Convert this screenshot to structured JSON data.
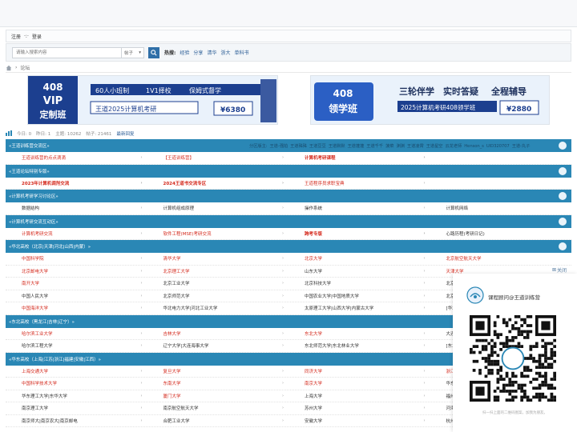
{
  "topbar": {
    "faint_text": ""
  },
  "userbar": {
    "register": "注册",
    "sep": "·:·",
    "login": "登录"
  },
  "search": {
    "placeholder": "请输入搜索内容",
    "type_value": "帖子",
    "hot_label": "热搜:",
    "hot_items": [
      "经验",
      "分享",
      "清华",
      "浙大",
      "单科书"
    ]
  },
  "breadcrumb": {
    "current": "论坛"
  },
  "banners": {
    "left": {
      "badge": "408",
      "vip": "VIP",
      "sub": "定制班",
      "tags": [
        "60人小班制",
        "1V1择校",
        "保姆式督学"
      ],
      "course": "王道2025计算机考研",
      "price": "¥6380"
    },
    "right": {
      "badge": "408",
      "sub": "领学班",
      "tags": [
        "三轮伴学",
        "实时答疑",
        "全程辅导"
      ],
      "course": "2025计算机考研408领学班",
      "price": "¥2880"
    }
  },
  "stats": {
    "today": "今日: 0",
    "yesterday": "昨日: 1",
    "topics": "主题: 10262",
    "posts": "帖子: 21461",
    "newest": "最新回复"
  },
  "sections": [
    {
      "title": "«王道训练营交流区»",
      "moderators_label": "分区版主:",
      "moderators": [
        "王道-强拍",
        "王道殊殊",
        "王道豆豆",
        "王道默默",
        "王道蓬蓬",
        "王道千千",
        "菠菜",
        "渊渊",
        "王道凌霄",
        "王道星空",
        "云龙老师",
        "Henson_s",
        "UID320707",
        "王道-丸子"
      ],
      "rows": [
        [
          {
            "t": "王道训练营的点点滴滴",
            "c": "red"
          },
          {
            "t": "【王道训练营】",
            "c": "red"
          },
          {
            "t": "计算机考研课程",
            "c": "red",
            "b": true
          },
          {
            "t": ""
          }
        ]
      ]
    },
    {
      "title": "«王道论坛特别专版»",
      "rows": [
        [
          {
            "t": "2023年计算机调剂交流",
            "c": "red",
            "b": true
          },
          {
            "t": "2024王道书交流专区",
            "c": "red",
            "b": true
          },
          {
            "t": "王道程序员求职宝典",
            "c": "red"
          },
          {
            "t": ""
          }
        ]
      ]
    },
    {
      "title": "«计算机考研学习讨论区»",
      "rows": [
        [
          {
            "t": "数据结构"
          },
          {
            "t": "计算机组成原理"
          },
          {
            "t": "操作系统"
          },
          {
            "t": "计算机网络"
          }
        ]
      ]
    },
    {
      "title": "«计算机考研交流互动区»",
      "rows": [
        [
          {
            "t": "计算机考研交流",
            "c": "red"
          },
          {
            "t": "软件工程(MSE)考研交流",
            "c": "red"
          },
          {
            "t": "跨考专版",
            "c": "red",
            "b": true
          },
          {
            "t": "心路历程(考研日记)"
          }
        ]
      ]
    },
    {
      "title": "«华北高校（北京|天津|河北|山西|内蒙）»",
      "rows": [
        [
          {
            "t": "中国科学院",
            "c": "red"
          },
          {
            "t": "清华大学",
            "c": "red"
          },
          {
            "t": "北京大学",
            "c": "red"
          },
          {
            "t": "北京航空航天大学",
            "c": "red"
          }
        ],
        [
          {
            "t": "北京邮电大学",
            "c": "red"
          },
          {
            "t": "北京理工大学",
            "c": "red"
          },
          {
            "t": "山东大学"
          },
          {
            "t": "天津大学",
            "c": "red"
          }
        ],
        [
          {
            "t": "南开大学",
            "c": "red"
          },
          {
            "t": "北京工业大学"
          },
          {
            "t": "北京科技大学"
          },
          {
            "t": "北京交通大学"
          }
        ],
        [
          {
            "t": "中国人民大学"
          },
          {
            "t": "北京师范大学"
          },
          {
            "t": "中国农业大学|中国地质大学"
          },
          {
            "t": "北京林业大学"
          }
        ],
        [
          {
            "t": "中国海洋大学",
            "c": "red"
          },
          {
            "t": "华北电力大学|河北工业大学"
          },
          {
            "t": "太原理工大学|山西大学|内蒙古大学"
          },
          {
            "t": "[华北]其他高校"
          }
        ]
      ]
    },
    {
      "title": "«东北高校（黑龙江|吉林|辽宁）»",
      "rows": [
        [
          {
            "t": "哈尔滨工业大学",
            "c": "red"
          },
          {
            "t": "吉林大学",
            "c": "red"
          },
          {
            "t": "东北大学",
            "c": "red"
          },
          {
            "t": "大连理工大学"
          }
        ],
        [
          {
            "t": "哈尔滨工程大学"
          },
          {
            "t": "辽宁大学|大连海事大学"
          },
          {
            "t": "东北师范大学|东北林业大学"
          },
          {
            "t": "[东北]其他高校"
          }
        ]
      ]
    },
    {
      "title": "«华东高校（上海|江苏|浙江|福建|安徽|江西）»",
      "rows": [
        [
          {
            "t": "上海交通大学",
            "c": "red"
          },
          {
            "t": "复旦大学",
            "c": "red"
          },
          {
            "t": "同济大学",
            "c": "red"
          },
          {
            "t": "浙江大学",
            "c": "red"
          }
        ],
        [
          {
            "t": "中国科学技术大学",
            "c": "red"
          },
          {
            "t": "东南大学",
            "c": "red"
          },
          {
            "t": "南京大学",
            "c": "red"
          },
          {
            "t": "华东师范大学"
          }
        ],
        [
          {
            "t": "华东理工大学|东华大学"
          },
          {
            "t": "厦门大学",
            "c": "red"
          },
          {
            "t": "上海大学"
          },
          {
            "t": "福州大学"
          }
        ],
        [
          {
            "t": "南京理工大学"
          },
          {
            "t": "南京航空航天大学"
          },
          {
            "t": "苏州大学"
          },
          {
            "t": "河海大学"
          }
        ],
        [
          {
            "t": "南京师大|南京农大|南京邮电"
          },
          {
            "t": "合肥工业大学"
          },
          {
            "t": "安徽大学"
          },
          {
            "t": "杭州电子科技大学"
          }
        ]
      ]
    }
  ],
  "qr": {
    "close": "关闭",
    "title": "课程顾问@王道训练营",
    "footer": "扫一扫上面的二维码图案，加我为朋友。"
  },
  "colors": {
    "accent": "#2a87b5",
    "link": "#2a5c95",
    "hot": "#d4281b"
  }
}
